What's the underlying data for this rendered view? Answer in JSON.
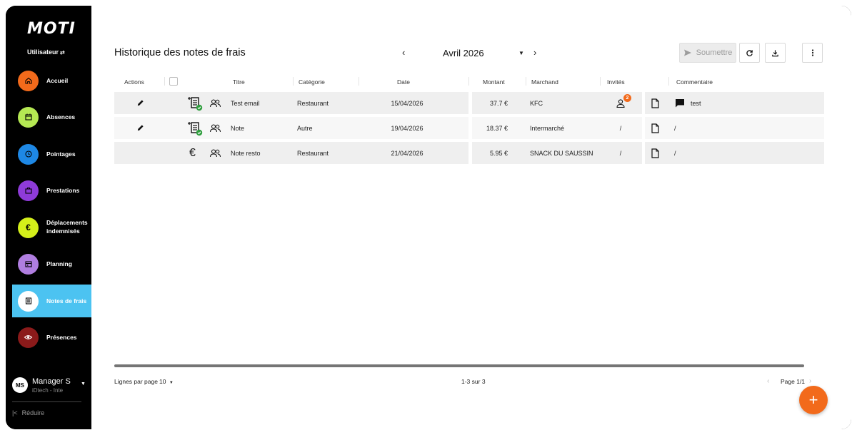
{
  "app": {
    "logo": "MOTI",
    "user_label": "Utilisateur",
    "user_switch_glyph": "⇄"
  },
  "sidebar": {
    "items": [
      {
        "label": "Accueil",
        "icon": "home-icon",
        "color": "#f26a1b"
      },
      {
        "label": "Absences",
        "icon": "calendar-icon",
        "color": "#b5e853"
      },
      {
        "label": "Pointages",
        "icon": "clock-icon",
        "color": "#1e88e5"
      },
      {
        "label": "Prestations",
        "icon": "briefcase-icon",
        "color": "#8e3bd8"
      },
      {
        "label": "Déplacements",
        "label2": "indemnisés",
        "icon": "euro-icon",
        "color": "#d4ef1a"
      },
      {
        "label": "Planning",
        "icon": "planning-icon",
        "color": "#b07ee0"
      },
      {
        "label": "Notes de frais",
        "icon": "receipt-icon",
        "color": "#ffffff",
        "active": true,
        "active_bg": "#4cc3f1"
      },
      {
        "label": "Présences",
        "icon": "eye-icon",
        "color": "#8b1a1a"
      }
    ],
    "profile": {
      "initials": "MS",
      "name": "Manager S",
      "org": "iDtech - Inte"
    },
    "reduce_label": "Réduire"
  },
  "header": {
    "title": "Historique des notes de frais",
    "month": "Avril 2026",
    "submit_label": "Soumettre"
  },
  "table": {
    "columns": [
      "Actions",
      "Titre",
      "Catégorie",
      "Date",
      "Montant",
      "Marchand",
      "Invités",
      "Commentaire"
    ],
    "rows": [
      {
        "editable": true,
        "type_icon": "receipt-check-icon",
        "title": "Test email",
        "category": "Restaurant",
        "date": "15/04/2026",
        "amount": "37.7 €",
        "merchant": "KFC",
        "guests_badge": "2",
        "comment": "test",
        "has_comment_icon": true
      },
      {
        "editable": true,
        "type_icon": "receipt-check-icon",
        "title": "Note",
        "category": "Autre",
        "date": "19/04/2026",
        "amount": "18.37 €",
        "merchant": "Intermarché",
        "guests": "/",
        "comment": "/",
        "has_comment_icon": false
      },
      {
        "editable": false,
        "type_icon": "euro-icon",
        "title": "Note resto",
        "category": "Restaurant",
        "date": "21/04/2026",
        "amount": "5.95 €",
        "merchant": "SNACK DU SAUSSIN",
        "guests": "/",
        "comment": "/",
        "has_comment_icon": false
      }
    ]
  },
  "footer": {
    "rows_per_page_label": "Lignes par page",
    "rows_per_page_value": "10",
    "range": "1-3 sur 3",
    "page": "Page 1/1"
  },
  "colors": {
    "accent": "#f26a1b",
    "active_nav": "#4cc3f1"
  }
}
